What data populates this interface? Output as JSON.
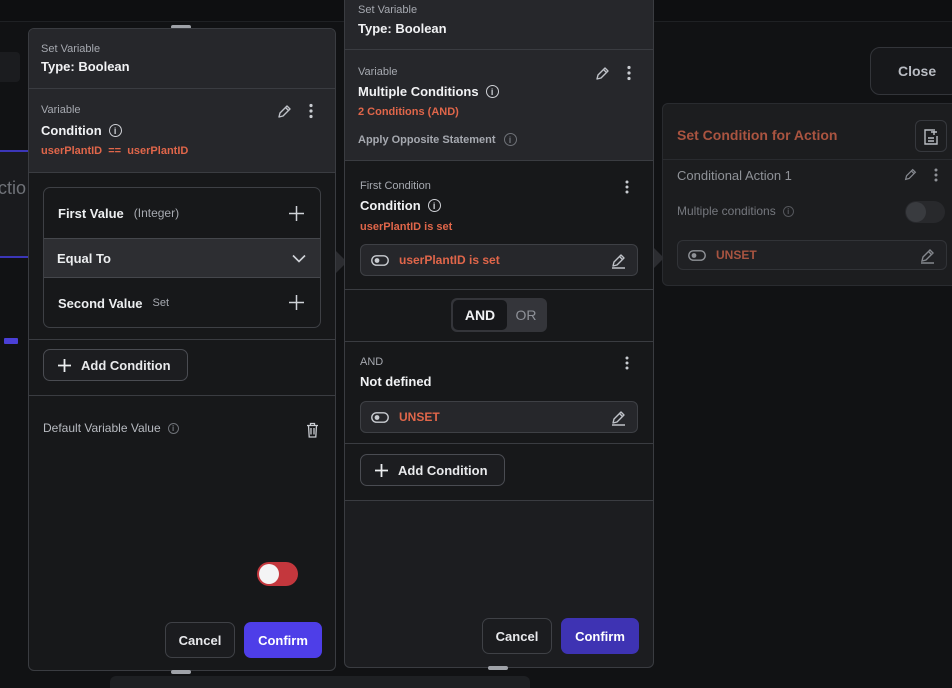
{
  "top_right": {
    "close_label": "Close"
  },
  "background": {
    "partial_label": "ctio"
  },
  "left_panel": {
    "header": {
      "kicker": "Set Variable",
      "type": "Type: Boolean"
    },
    "variable": {
      "label": "Variable",
      "title": "Condition",
      "expression": "userPlantID  ==  userPlantID"
    },
    "condition": {
      "first_value_label": "First Value",
      "first_value_type": "(Integer)",
      "operator": "Equal To",
      "second_value_label": "Second Value",
      "second_value_state": "Set"
    },
    "add_condition_label": "Add Condition",
    "default_value_label": "Default Variable Value",
    "default_value_on": true,
    "cancel_label": "Cancel",
    "confirm_label": "Confirm"
  },
  "middle_panel": {
    "header": {
      "kicker": "Set Variable",
      "type": "Type: Boolean"
    },
    "variable": {
      "label": "Variable",
      "title": "Multiple Conditions",
      "summary": "2 Conditions (AND)",
      "opposite_label": "Apply Opposite Statement",
      "opposite_on": false
    },
    "first_condition": {
      "label": "First Condition",
      "title": "Condition",
      "subtitle": "userPlantID is set",
      "pill_text": "userPlantID is set"
    },
    "logic": {
      "and_label": "AND",
      "or_label": "OR",
      "selected": "AND"
    },
    "second_condition": {
      "label": "AND",
      "title": "Not defined",
      "pill_text": "UNSET"
    },
    "add_condition_label": "Add Condition",
    "cancel_label": "Cancel",
    "confirm_label": "Confirm"
  },
  "right_panel": {
    "title": "Set Condition for Action",
    "action_label": "Conditional Action 1",
    "multiple_label": "Multiple conditions",
    "pill_text": "UNSET"
  },
  "colors": {
    "accent": "#4e3ee8",
    "orange": "#e0664a",
    "toggle_on": "#c4373d"
  }
}
